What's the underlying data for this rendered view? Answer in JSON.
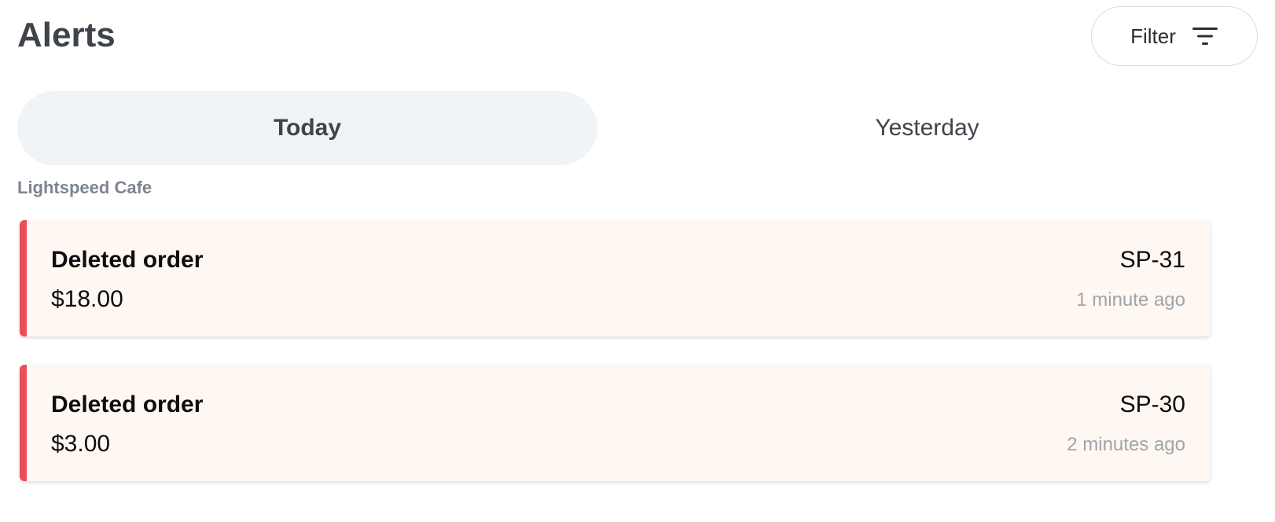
{
  "header": {
    "title": "Alerts",
    "filter_label": "Filter",
    "filter_icon": "filter-lines-icon"
  },
  "tabs": [
    {
      "label": "Today",
      "active": true
    },
    {
      "label": "Yesterday",
      "active": false
    }
  ],
  "section": {
    "label": "Lightspeed Cafe"
  },
  "alerts": [
    {
      "title": "Deleted order",
      "amount": "$18.00",
      "reference": "SP-31",
      "time": "1 minute ago"
    },
    {
      "title": "Deleted order",
      "amount": "$3.00",
      "reference": "SP-30",
      "time": "2 minutes ago"
    }
  ],
  "colors": {
    "alert_accent": "#e84d5a",
    "alert_background": "#fff7f2",
    "active_tab_background": "#f0f4f7"
  }
}
